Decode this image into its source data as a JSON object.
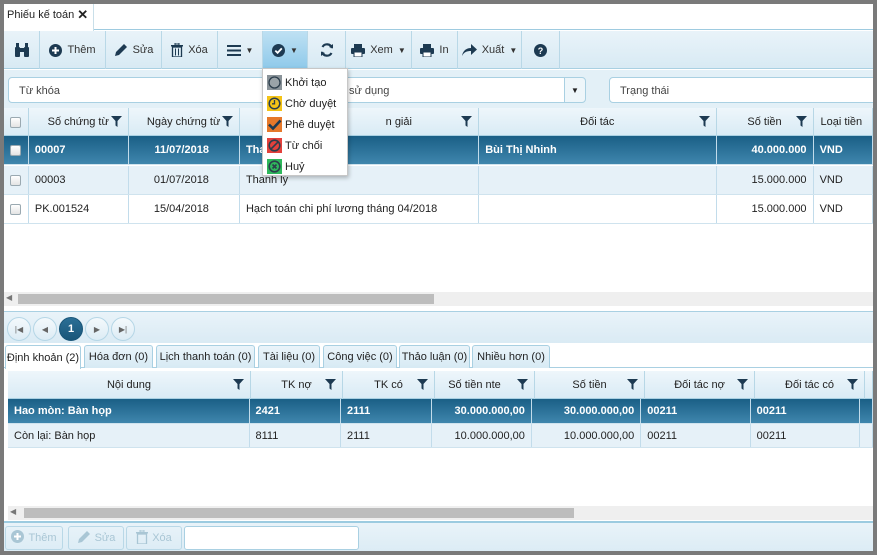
{
  "window": {
    "tab_title": "Phiếu kế toán",
    "close_glyph": "✕"
  },
  "toolbar": {
    "find_icon": "binoculars-icon",
    "add_label": "Thêm",
    "edit_label": "Sửa",
    "delete_label": "Xóa",
    "menu_caret": "▼",
    "approve_caret": "▼",
    "view_label": "Xem",
    "view_caret": "▼",
    "print_label": "In",
    "export_label": "Xuất",
    "export_caret": "▼"
  },
  "status_menu": {
    "items": [
      {
        "label": "Khởi tạo",
        "icon": "circle-icon",
        "color": "#8a9399"
      },
      {
        "label": "Chờ duyệt",
        "icon": "clock-icon",
        "color": "#f4c316"
      },
      {
        "label": "Phê duyệt",
        "icon": "check-icon",
        "color": "#e6782a"
      },
      {
        "label": "Từ chối",
        "icon": "ban-icon",
        "color": "#e3413c"
      },
      {
        "label": "Huỷ",
        "icon": "cancel-circle-icon",
        "color": "#2eb85c"
      }
    ]
  },
  "filters": {
    "keyword_placeholder": "Từ khóa",
    "usage_placeholder": "sử dụng",
    "combo_caret": "▼",
    "status_placeholder": "Trạng thái"
  },
  "main_grid": {
    "columns": [
      "Số chứng từ",
      "Ngày chứng từ",
      "Diễn giải",
      "Đối tác",
      "Số tiền",
      "Loại tiền"
    ],
    "description_header_visible": "n giải",
    "rows": [
      {
        "so": "00007",
        "ngay": "11/07/2018",
        "dien_giai": "Tha",
        "doi_tac": "Bùi Thị Nhinh",
        "so_tien": "40.000.000",
        "loai_tien": "VND",
        "selected": true
      },
      {
        "so": "00003",
        "ngay": "01/07/2018",
        "dien_giai": "Thanh lý",
        "doi_tac": "",
        "so_tien": "15.000.000",
        "loai_tien": "VND",
        "selected": false
      },
      {
        "so": "PK.001524",
        "ngay": "15/04/2018",
        "dien_giai": "Hạch toán chi phí lương tháng 04/2018",
        "doi_tac": "",
        "so_tien": "15.000.000",
        "loai_tien": "VND",
        "selected": false
      }
    ]
  },
  "pager": {
    "first": "⏮",
    "prev": "◀",
    "current_page": "1",
    "next": "▶",
    "last": "⏭"
  },
  "detail_tabs": [
    {
      "label": "Định khoản (2)",
      "active": true
    },
    {
      "label": "Hóa đơn (0)",
      "active": false
    },
    {
      "label": "Lịch thanh toán (0)",
      "active": false
    },
    {
      "label": "Tài liệu (0)",
      "active": false
    },
    {
      "label": "Công việc (0)",
      "active": false
    },
    {
      "label": "Thảo luận (0)",
      "active": false
    },
    {
      "label": "Nhiều hơn (0)",
      "active": false
    }
  ],
  "detail_grid": {
    "columns": [
      "Nội dung",
      "TK nợ",
      "TK có",
      "Số tiền nte",
      "Số tiền",
      "Đối tác nợ",
      "Đối tác có"
    ],
    "rows": [
      {
        "noi_dung": "Hao mòn: Bàn họp",
        "tk_no": "2421",
        "tk_co": "2111",
        "so_tien_nte": "30.000.000,00",
        "so_tien": "30.000.000,00",
        "dt_no": "00211",
        "dt_co": "00211",
        "selected": true
      },
      {
        "noi_dung": "Còn lại: Bàn họp",
        "tk_no": "8111",
        "tk_co": "2111",
        "so_tien_nte": "10.000.000,00",
        "so_tien": "10.000.000,00",
        "dt_no": "00211",
        "dt_co": "00211",
        "selected": false
      }
    ]
  },
  "bottom_toolbar": {
    "add_label": "Thêm",
    "edit_label": "Sửa",
    "delete_label": "Xóa",
    "input_value": ""
  },
  "colors": {
    "accent": "#1f6a92",
    "selected_row": "#256f98",
    "header_bg": "#dcecf5"
  }
}
